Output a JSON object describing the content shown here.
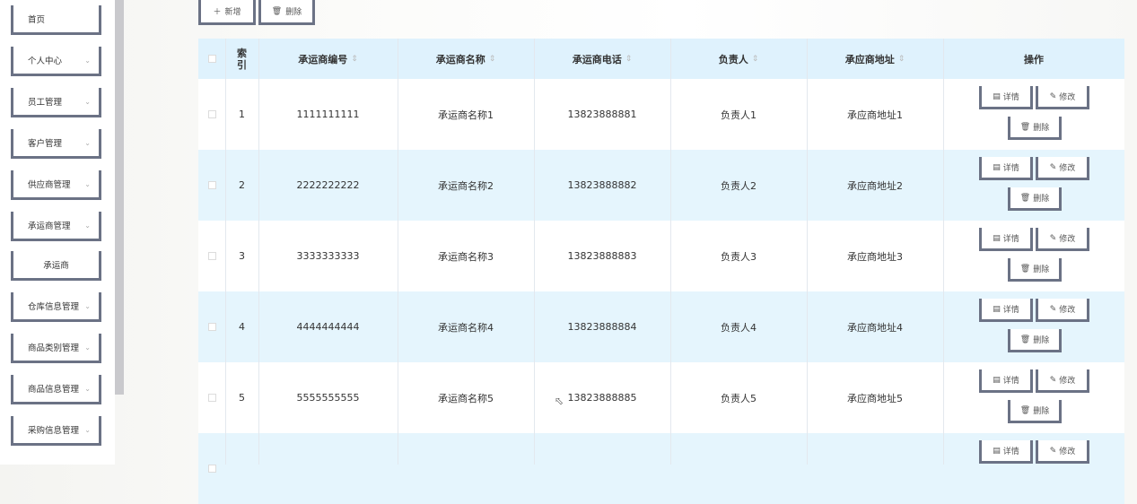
{
  "sidebar": {
    "items": [
      {
        "label": "首页",
        "chevron": false,
        "sub": false
      },
      {
        "label": "个人中心",
        "chevron": true,
        "sub": false
      },
      {
        "label": "员工管理",
        "chevron": true,
        "sub": false
      },
      {
        "label": "客户管理",
        "chevron": true,
        "sub": false
      },
      {
        "label": "供应商管理",
        "chevron": true,
        "sub": false
      },
      {
        "label": "承运商管理",
        "chevron": true,
        "sub": false
      },
      {
        "label": "承运商",
        "chevron": false,
        "sub": true
      },
      {
        "label": "仓库信息管理",
        "chevron": true,
        "sub": false
      },
      {
        "label": "商品类别管理",
        "chevron": true,
        "sub": false
      },
      {
        "label": "商品信息管理",
        "chevron": true,
        "sub": false
      },
      {
        "label": "采购信息管理",
        "chevron": true,
        "sub": false
      }
    ]
  },
  "toolbar": {
    "add_label": "新增",
    "add_icon": "plus-icon",
    "delete_label": "删除",
    "delete_icon": "trash-icon"
  },
  "table": {
    "columns": [
      {
        "label": "",
        "key": "checkbox",
        "sortable": false
      },
      {
        "label": "索引",
        "key": "index",
        "sortable": false
      },
      {
        "label": "承运商编号",
        "key": "code",
        "sortable": true
      },
      {
        "label": "承运商名称",
        "key": "name",
        "sortable": true
      },
      {
        "label": "承运商电话",
        "key": "phone",
        "sortable": true
      },
      {
        "label": "负责人",
        "key": "manager",
        "sortable": true
      },
      {
        "label": "承应商地址",
        "key": "address",
        "sortable": true
      },
      {
        "label": "操作",
        "key": "actions",
        "sortable": false
      }
    ],
    "rows": [
      {
        "index": "1",
        "code": "1111111111",
        "name": "承运商名称1",
        "phone": "13823888881",
        "manager": "负责人1",
        "address": "承应商地址1"
      },
      {
        "index": "2",
        "code": "2222222222",
        "name": "承运商名称2",
        "phone": "13823888882",
        "manager": "负责人2",
        "address": "承应商地址2"
      },
      {
        "index": "3",
        "code": "3333333333",
        "name": "承运商名称3",
        "phone": "13823888883",
        "manager": "负责人3",
        "address": "承应商地址3"
      },
      {
        "index": "4",
        "code": "4444444444",
        "name": "承运商名称4",
        "phone": "13823888884",
        "manager": "负责人4",
        "address": "承应商地址4"
      },
      {
        "index": "5",
        "code": "5555555555",
        "name": "承运商名称5",
        "phone": "13823888885",
        "manager": "负责人5",
        "address": "承应商地址5"
      },
      {
        "index": "",
        "code": "",
        "name": "",
        "phone": "",
        "manager": "",
        "address": ""
      }
    ],
    "actions": {
      "detail_label": "详情",
      "edit_label": "修改",
      "delete_label": "删除"
    },
    "sort_glyph": "⇕"
  },
  "colors": {
    "header_bg": "#dff2fd",
    "alt_row_bg": "#e5f5fd",
    "button_border": "#6b7285"
  }
}
